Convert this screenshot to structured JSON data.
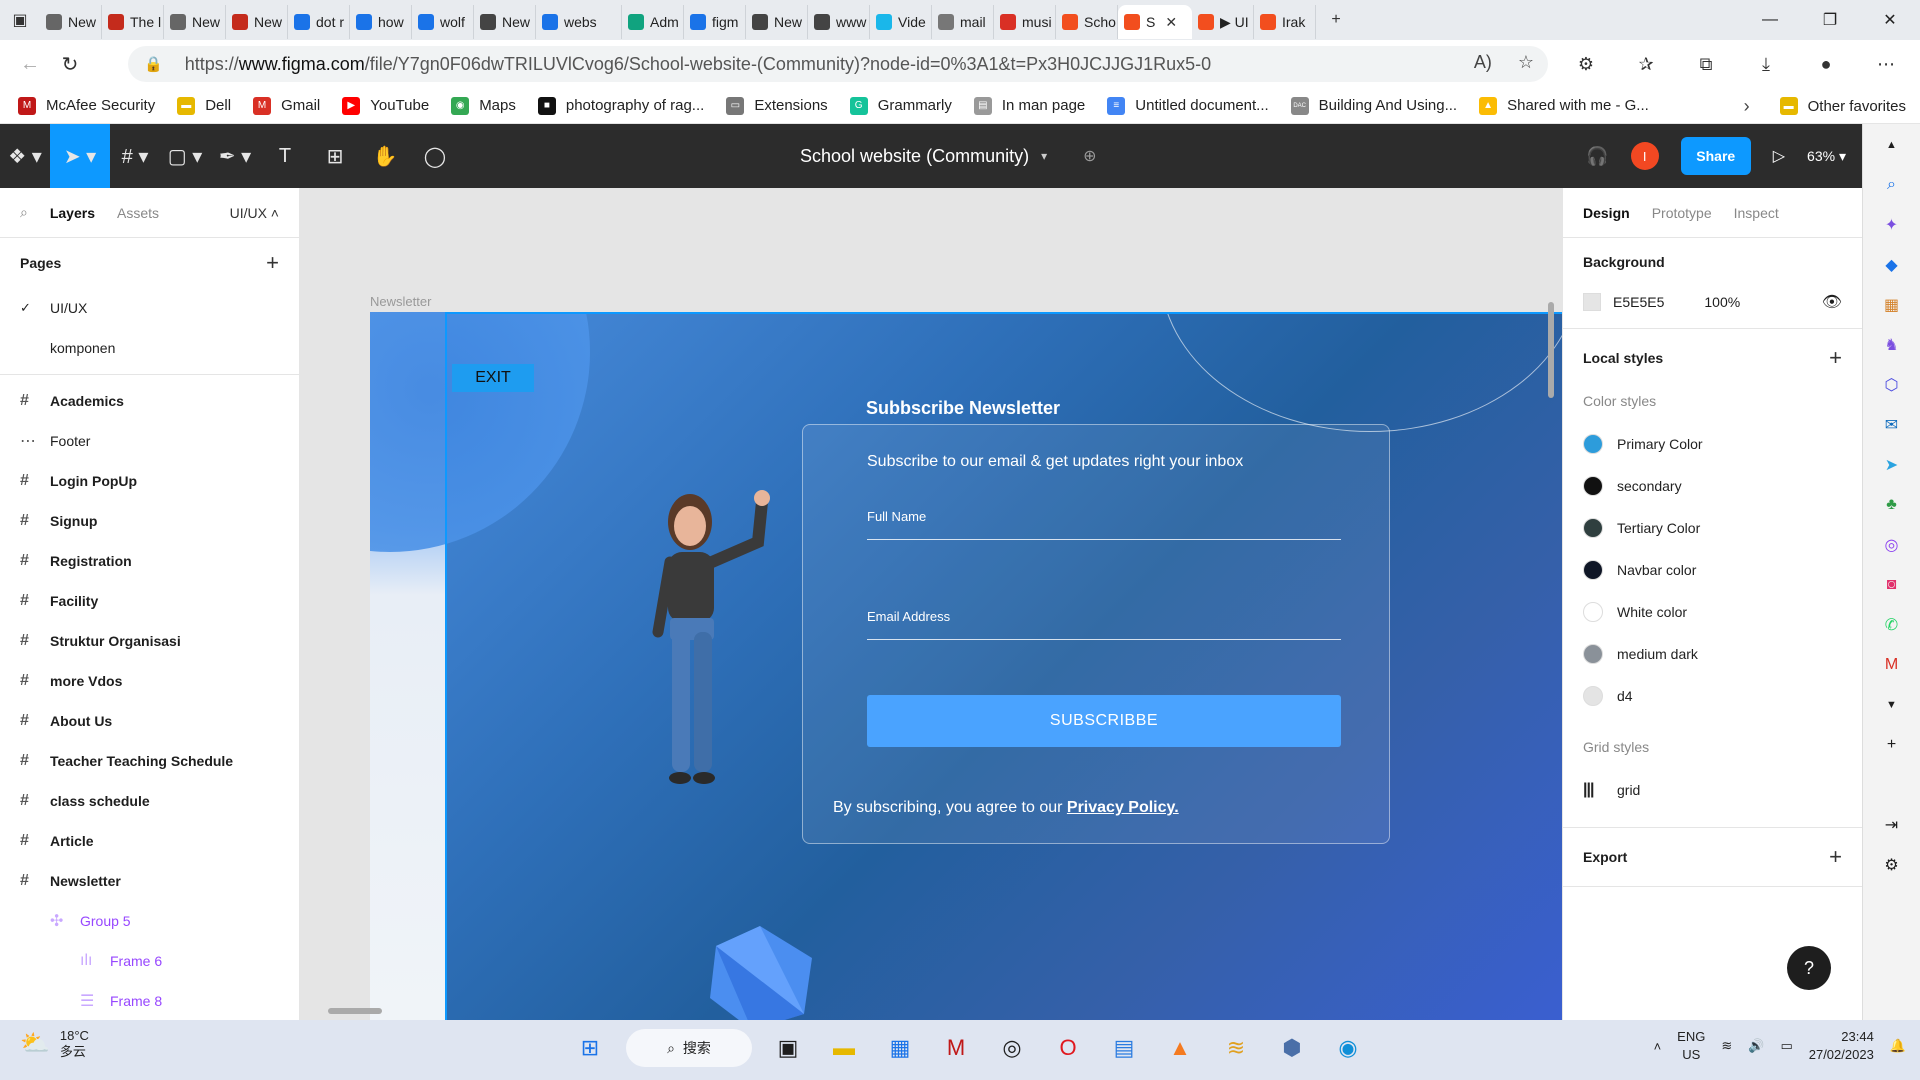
{
  "browser": {
    "tabs": [
      {
        "label": "New",
        "color": "#666"
      },
      {
        "label": "The l",
        "color": "#c42b1c"
      },
      {
        "label": "New",
        "color": "#666"
      },
      {
        "label": "New",
        "color": "#c42b1c"
      },
      {
        "label": "dot r",
        "color": "#1a73e8"
      },
      {
        "label": "how",
        "color": "#1a73e8"
      },
      {
        "label": "wolf",
        "color": "#1a73e8"
      },
      {
        "label": "New",
        "color": "#444"
      },
      {
        "label": "webs",
        "color": "#1a73e8"
      },
      {
        "label": "Adm",
        "color": "#10a37f"
      },
      {
        "label": "figm",
        "color": "#1a73e8"
      },
      {
        "label": "New",
        "color": "#444"
      },
      {
        "label": "www",
        "color": "#444"
      },
      {
        "label": "Vide",
        "color": "#1ab7ea"
      },
      {
        "label": "mail",
        "color": "#777"
      },
      {
        "label": "musi",
        "color": "#d93025"
      },
      {
        "label": "Scho",
        "color": "#f24e1e"
      },
      {
        "label": "S",
        "color": "#f24e1e",
        "active": true
      },
      {
        "label": "▶ UI",
        "color": "#f24e1e"
      },
      {
        "label": "Irak",
        "color": "#f24e1e"
      }
    ],
    "url_prefix": "https://",
    "url_host": "www.figma.com",
    "url_path": "/file/Y7gn0F06dwTRILUVlCvog6/School-website-(Community)?node-id=0%3A1&t=Px3H0JCJJGJ1Rux5-0",
    "bookmarks": [
      {
        "label": "McAfee Security",
        "color": "#c01818",
        "glyph": "M"
      },
      {
        "label": "Dell",
        "color": "#e6b800",
        "glyph": "▬"
      },
      {
        "label": "Gmail",
        "color": "#d93025",
        "glyph": "M"
      },
      {
        "label": "YouTube",
        "color": "#ff0000",
        "glyph": "▶"
      },
      {
        "label": "Maps",
        "color": "#34a853",
        "glyph": "◉"
      },
      {
        "label": "photography of rag...",
        "color": "#111",
        "glyph": "■"
      },
      {
        "label": "Extensions",
        "color": "#777",
        "glyph": "▭"
      },
      {
        "label": "Grammarly",
        "color": "#15c39a",
        "glyph": "G"
      },
      {
        "label": "In man page",
        "color": "#999",
        "glyph": "▤"
      },
      {
        "label": "Untitled document...",
        "color": "#4285f4",
        "glyph": "≡"
      },
      {
        "label": "Building And Using...",
        "color": "#888",
        "glyph": "DAC"
      },
      {
        "label": "Shared with me - G...",
        "color": "#fbbc04",
        "glyph": "▲"
      }
    ],
    "other_favorites": "Other favorites"
  },
  "figma": {
    "file_title": "School website (Community)",
    "share_label": "Share",
    "zoom": "63%",
    "avatar_letter": "I",
    "left": {
      "tab_layers": "Layers",
      "tab_assets": "Assets",
      "page_selector": "UI/UX",
      "pages_header": "Pages",
      "pages": [
        {
          "label": "UI/UX",
          "current": true
        },
        {
          "label": "komponen",
          "current": false
        }
      ],
      "layers": [
        {
          "label": "Academics",
          "icon": "#",
          "style": "bold"
        },
        {
          "label": "Footer",
          "icon": "⋯",
          "style": "normal"
        },
        {
          "label": "Login PopUp",
          "icon": "#",
          "style": "bold"
        },
        {
          "label": "Signup",
          "icon": "#",
          "style": "bold"
        },
        {
          "label": "Registration",
          "icon": "#",
          "style": "bold"
        },
        {
          "label": "Facility",
          "icon": "#",
          "style": "bold"
        },
        {
          "label": "Struktur Organisasi",
          "icon": "#",
          "style": "bold"
        },
        {
          "label": "more Vdos",
          "icon": "#",
          "style": "bold"
        },
        {
          "label": "About Us",
          "icon": "#",
          "style": "bold"
        },
        {
          "label": "Teacher Teaching Schedule",
          "icon": "#",
          "style": "bold"
        },
        {
          "label": "class schedule",
          "icon": "#",
          "style": "bold"
        },
        {
          "label": "Article",
          "icon": "#",
          "style": "bold"
        },
        {
          "label": "Newsletter",
          "icon": "#",
          "style": "bold"
        },
        {
          "label": "Group 5",
          "icon": "✣",
          "style": "child"
        },
        {
          "label": "Frame 6",
          "icon": "ılı",
          "style": "child-sub"
        },
        {
          "label": "Frame 8",
          "icon": "☰",
          "style": "child-sub"
        }
      ]
    },
    "canvas": {
      "frame_label": "Newsletter",
      "exit_label": "EXIT",
      "title": "Subbscribe Newsletter",
      "subtitle": "Subscribe to our email & get updates right  your inbox",
      "field_name": "Full Name",
      "field_email": "Email Address",
      "button": "SUBSCRIBBE",
      "policy_text": "By subscribing, you agree to our ",
      "policy_link": "Privacy Policy."
    },
    "right": {
      "tab_design": "Design",
      "tab_prototype": "Prototype",
      "tab_inspect": "Inspect",
      "background_header": "Background",
      "background_hex": "E5E5E5",
      "background_opacity": "100%",
      "local_styles_header": "Local styles",
      "color_styles_header": "Color styles",
      "color_styles": [
        {
          "label": "Primary Color",
          "color": "#2d9cdb"
        },
        {
          "label": "secondary",
          "color": "#111111"
        },
        {
          "label": "Tertiary Color",
          "color": "#2f3f3f"
        },
        {
          "label": "Navbar color",
          "color": "#0f1626"
        },
        {
          "label": "White color",
          "color": "#ffffff"
        },
        {
          "label": "medium dark",
          "color": "#8a9199"
        },
        {
          "label": "d4",
          "color": "#e4e4e4"
        }
      ],
      "grid_styles_header": "Grid styles",
      "grid_style": "grid",
      "export_header": "Export",
      "help": "?"
    }
  },
  "taskbar": {
    "temp": "18°C",
    "weather": "多云",
    "search": "搜索",
    "lang": "ENG",
    "region": "US",
    "time": "23:44",
    "date": "27/02/2023"
  }
}
